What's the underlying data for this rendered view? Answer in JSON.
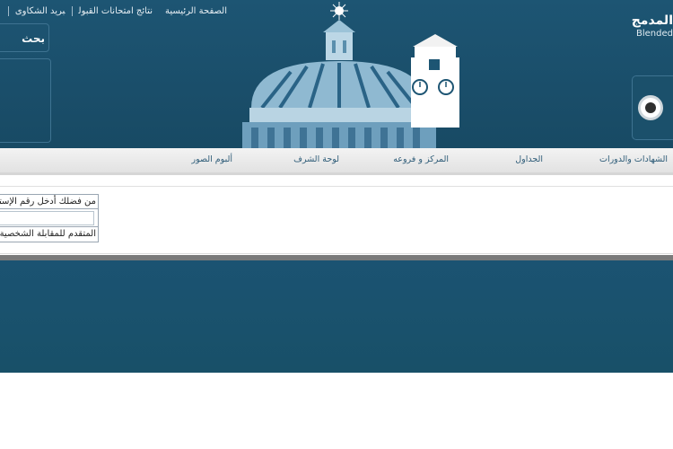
{
  "header": {
    "links": [
      "الصفحة الرئيسية",
      "نتائج امتحانات القبول",
      "بريد الشكاوى"
    ],
    "search_label": "بحث",
    "logo_ar": "المدمج",
    "logo_en": "Blended"
  },
  "nav": {
    "items": [
      "الشهادات والدورات",
      "الجداول",
      "المركز و فروعه",
      "لوحة الشرف",
      "ألبوم الصور"
    ]
  },
  "form": {
    "prompt": "من فضلك أدخل رقم الإستمارة",
    "input_value": "",
    "note": "المتقدم للمقابلة الشخصية"
  }
}
